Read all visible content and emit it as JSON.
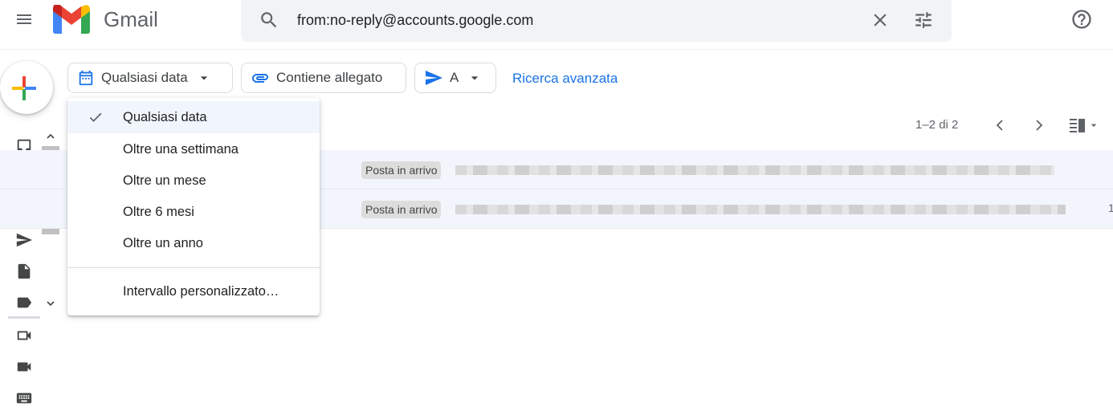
{
  "header": {
    "app_name": "Gmail",
    "search_value": "from:no-reply@accounts.google.com"
  },
  "filters": {
    "date_chip": "Qualsiasi data",
    "attachment_chip": "Contiene allegato",
    "to_chip": "A",
    "advanced_search": "Ricerca avanzata"
  },
  "pager": {
    "range": "1–2 di 2"
  },
  "messages": [
    {
      "label": "Posta in arrivo",
      "trail": ""
    },
    {
      "label": "Posta in arrivo",
      "trail": "1"
    }
  ],
  "date_menu": {
    "options": [
      "Qualsiasi data",
      "Oltre una settimana",
      "Oltre un mese",
      "Oltre 6 mesi",
      "Oltre un anno",
      "Intervallo personalizzato…"
    ],
    "selected": "Qualsiasi data"
  },
  "colors": {
    "accent": "#1a73e8",
    "selected_row": "#f2f6fc"
  }
}
